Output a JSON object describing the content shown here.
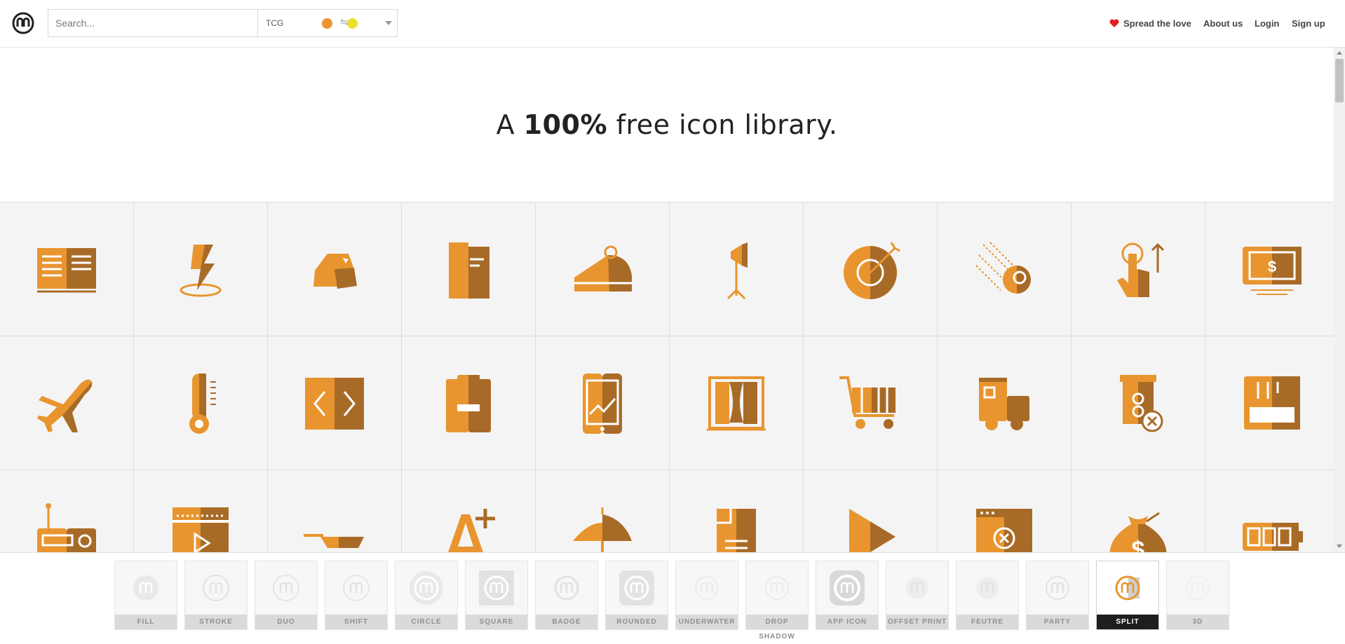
{
  "header": {
    "search_placeholder": "Search...",
    "palette": {
      "label": "TCG",
      "color_a": "#E8952F",
      "color_b": "#EDE02C"
    },
    "nav": {
      "spread": "Spread the love",
      "about": "About us",
      "login": "Login",
      "signup": "Sign up"
    }
  },
  "hero": {
    "prefix": "A ",
    "bold": "100%",
    "suffix": " free icon library."
  },
  "colors": {
    "light": "#E8952F",
    "dark": "#A86B27",
    "grid_bg": "#F4F4F4",
    "heart": "#E0201F"
  },
  "icons": [
    "open-book-icon",
    "lightning-location-icon",
    "rocks-icon",
    "document-split-icon",
    "cake-slice-icon",
    "studio-light-icon",
    "target-dart-icon",
    "meteor-icon",
    "tap-up-gesture-icon",
    "money-bill-icon",
    "airplane-icon",
    "thermometer-icon",
    "code-brackets-icon",
    "clipboard-minus-icon",
    "mobile-chart-icon",
    "theater-curtain-icon",
    "shopping-cart-icon",
    "delivery-truck-icon",
    "atm-cancel-icon",
    "cash-register-icon",
    "radio-icon",
    "video-player-icon",
    "frying-pan-icon",
    "font-increase-icon",
    "umbrella-icon",
    "document-corner-icon",
    "play-triangle-icon",
    "browser-error-icon",
    "money-bag-icon",
    "battery-icon"
  ],
  "styles": [
    {
      "label": "FILL"
    },
    {
      "label": "STROKE"
    },
    {
      "label": "DUO"
    },
    {
      "label": "SHIFT"
    },
    {
      "label": "CIRCLE"
    },
    {
      "label": "SQUARE"
    },
    {
      "label": "BADGE"
    },
    {
      "label": "ROUNDED"
    },
    {
      "label": "UNDERWATER"
    },
    {
      "label": "DROP SHADOW"
    },
    {
      "label": "APP ICON"
    },
    {
      "label": "OFFSET PRINT"
    },
    {
      "label": "FEUTRE"
    },
    {
      "label": "PARTY"
    },
    {
      "label": "SPLIT"
    },
    {
      "label": "3D"
    }
  ],
  "active_style": "SPLIT"
}
